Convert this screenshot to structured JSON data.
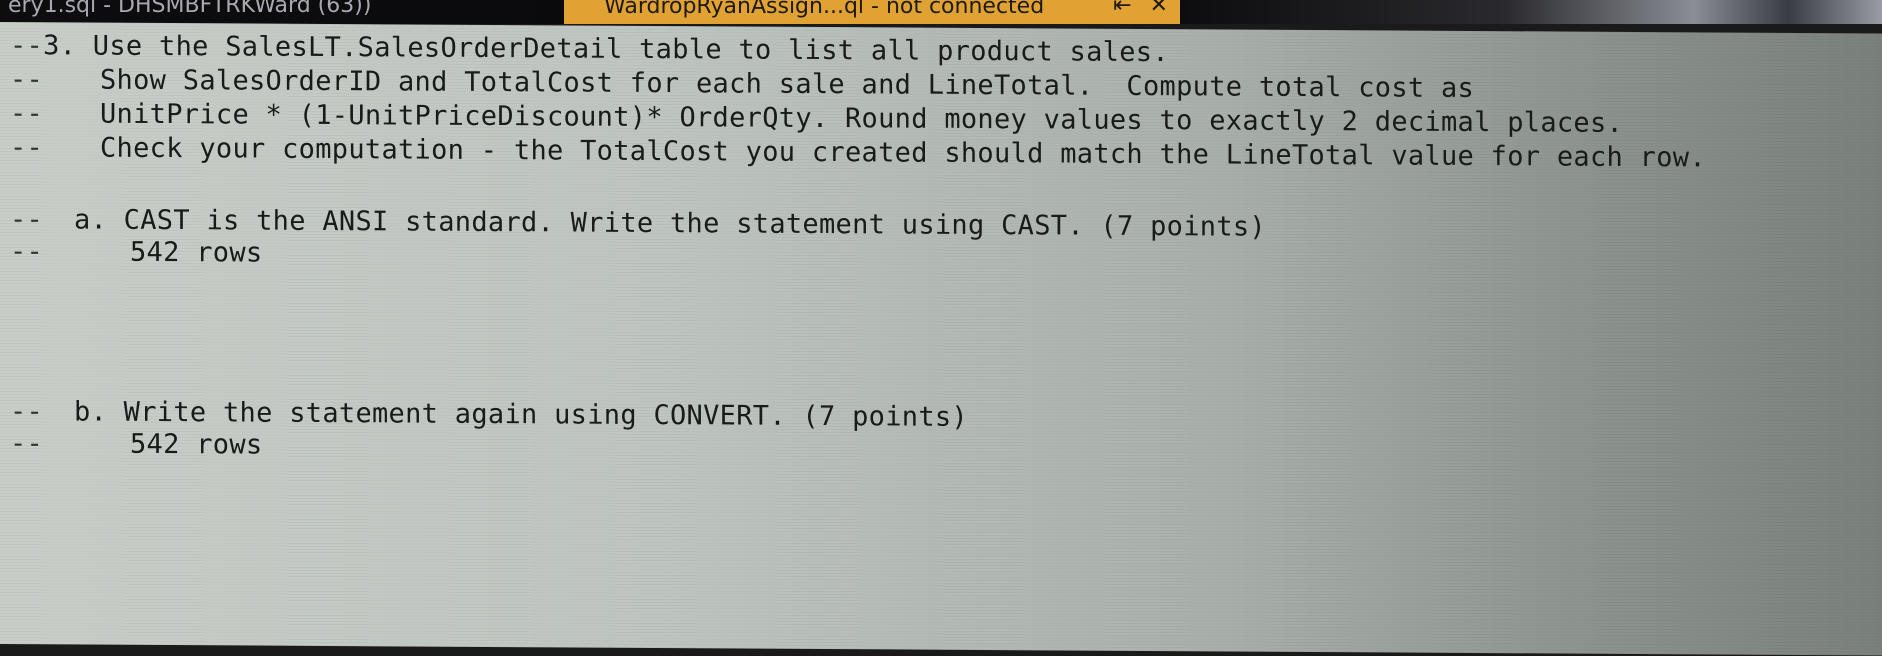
{
  "tabs": {
    "inactive": {
      "label": "ery1.sql - DHSMBFTRKWard (63))"
    },
    "active": {
      "label": "WardropRyanAssign...ql - not connected",
      "pin_icon": "pin-icon",
      "close_icon": "close-icon",
      "pin_glyph": "⇤",
      "close_glyph": "✕",
      "accent_color": "#e0a232"
    }
  },
  "editor": {
    "comment_prefix": "--",
    "lines": [
      {
        "prefix": "--",
        "text": "3. Use the SalesLT.SalesOrderDetail table to list all product sales."
      },
      {
        "prefix": "--",
        "text": "Show SalesOrderID and TotalCost for each sale and LineTotal.  Compute total cost as"
      },
      {
        "prefix": "--",
        "text": "UnitPrice * (1-UnitPriceDiscount)* OrderQty. Round money values to exactly 2 decimal places."
      },
      {
        "prefix": "--",
        "text": "Check your computation - the TotalCost you created should match the LineTotal value for each row."
      },
      {
        "prefix": "--",
        "text": "a. CAST is the ANSI standard. Write the statement using CAST. (7 points)"
      },
      {
        "prefix": "--",
        "text": "542 rows"
      },
      {
        "prefix": "--",
        "text": "b. Write the statement again using CONVERT. (7 points)"
      },
      {
        "prefix": "--",
        "text": "542 rows"
      }
    ]
  }
}
